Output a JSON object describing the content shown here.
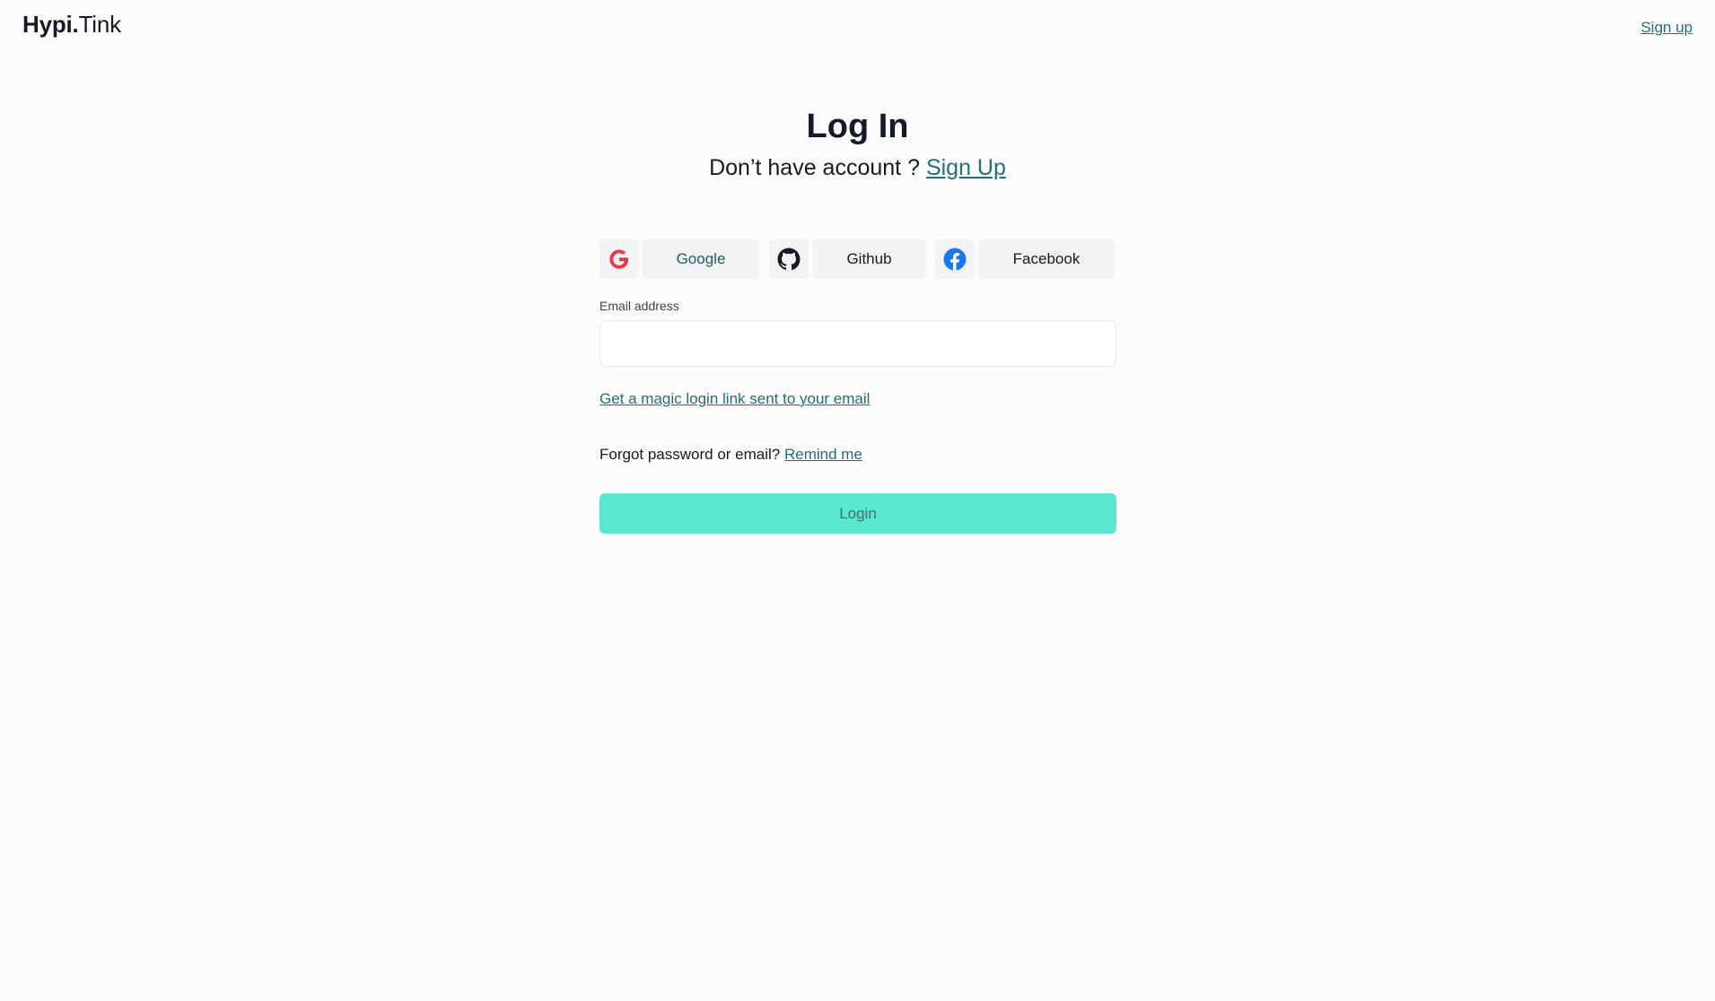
{
  "header": {
    "logo_strong": "Hypi.",
    "logo_light": "Tink",
    "signup_link": "Sign up"
  },
  "main": {
    "title": "Log In",
    "subtitle_prefix": "Don’t have account ?",
    "subtitle_link": "Sign Up"
  },
  "social": {
    "google": {
      "label": "Google",
      "icon": "google-icon",
      "icon_color": "#e53947"
    },
    "github": {
      "label": "Github",
      "icon": "github-icon",
      "icon_color": "#141a26"
    },
    "facebook": {
      "label": "Facebook",
      "icon": "facebook-icon",
      "icon_color": "#1a77f2"
    }
  },
  "form": {
    "email_label": "Email address",
    "email_value": "",
    "email_placeholder": "",
    "magic_link": "Get a magic login link sent to your email",
    "forgot_prefix": "Forgot password or email?",
    "forgot_link": "Remind me",
    "login_label": "Login"
  },
  "colors": {
    "accent": "#59e8cf",
    "link": "#226f7a",
    "text": "#141a26",
    "background": "#fcfcfc"
  }
}
